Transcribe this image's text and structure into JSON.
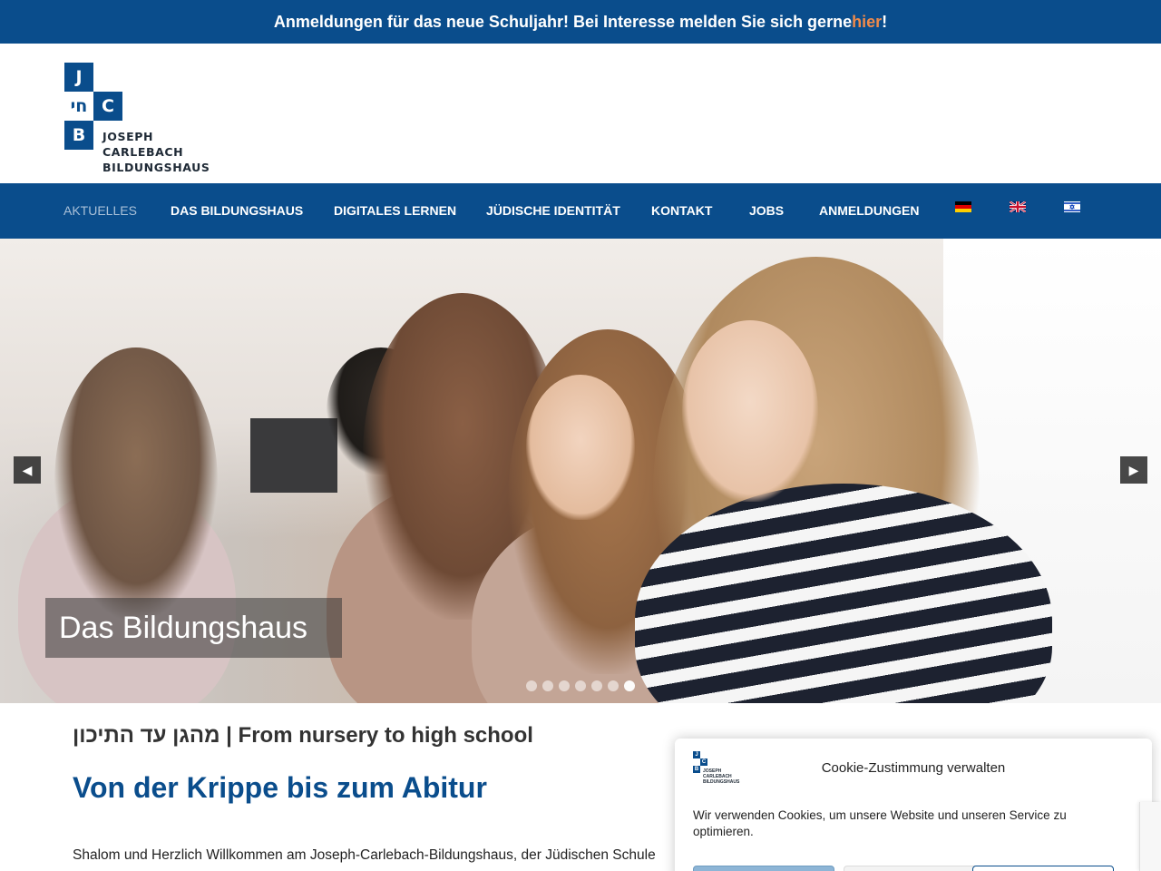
{
  "announcement": {
    "text_before": "Anmeldungen für das neue Schuljahr! Bei Interesse melden Sie sich gerne ",
    "link_text": "hier",
    "text_after": "!"
  },
  "logo": {
    "letter_j": "J",
    "letter_c": "C",
    "letter_b": "B",
    "hebrew": "חי",
    "line1": "JOSEPH",
    "line2": "CARLEBACH",
    "line3": "BILDUNGSHAUS"
  },
  "nav": {
    "items": [
      {
        "label": "AKTUELLES",
        "active": true
      },
      {
        "label": "DAS BILDUNGSHAUS"
      },
      {
        "label": "DIGITALES LERNEN"
      },
      {
        "label": "JÜDISCHE IDENTITÄT"
      },
      {
        "label": "KONTAKT"
      },
      {
        "label": "JOBS"
      },
      {
        "label": "ANMELDUNGEN"
      }
    ],
    "flags": [
      "flag-de-icon",
      "flag-uk-icon",
      "flag-il-icon"
    ]
  },
  "slider": {
    "caption": "Das Bildungshaus",
    "prev_icon": "chevron-left-icon",
    "next_icon": "chevron-right-icon",
    "slide_count": 7,
    "active_slide": 7,
    "prev_glyph": "◀",
    "next_glyph": "▶"
  },
  "content": {
    "subtitle": "מהגן עד התיכון | From nursery to high school",
    "title": "Von der Krippe bis zum Abitur",
    "intro": "Shalom und Herzlich Willkommen am Joseph-Carlebach-Bildungshaus, der Jüdischen Schule"
  },
  "cookie": {
    "title": "Cookie-Zustimmung verwalten",
    "text": "Wir verwenden Cookies, um unsere Website und unseren Service zu optimieren."
  },
  "colors": {
    "brand": "#0a4d8c",
    "accent": "#f08a4b"
  }
}
